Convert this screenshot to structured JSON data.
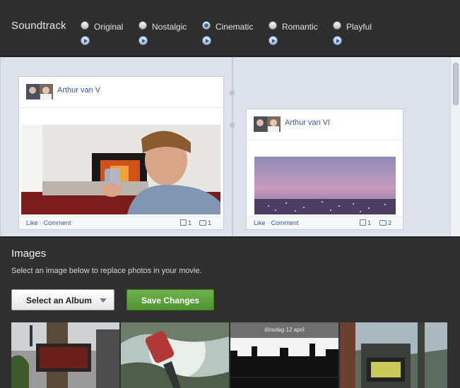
{
  "soundtrack": {
    "title": "Soundtrack",
    "options": [
      {
        "label": "Original",
        "checked": false
      },
      {
        "label": "Nostalgic",
        "checked": false
      },
      {
        "label": "Cinematic",
        "checked": true
      },
      {
        "label": "Romantic",
        "checked": false
      },
      {
        "label": "Playful",
        "checked": false
      }
    ]
  },
  "timeline": {
    "posts": [
      {
        "author": "Arthur van V",
        "like_label": "Like",
        "separator": "·",
        "comment_label": "Comment",
        "likes": "1",
        "comments": "1"
      },
      {
        "author": "Arthur van Vl",
        "like_label": "Like",
        "separator": "·",
        "comment_label": "Comment",
        "likes": "1",
        "comments": "2"
      }
    ]
  },
  "images": {
    "title": "Images",
    "subtitle": "Select an image below to replace photos in your movie.",
    "album_select_label": "Select an Album",
    "save_label": "Save Changes",
    "thumbnails": [
      {
        "name": "theater-sign-photo"
      },
      {
        "name": "tree-canopy-photo"
      },
      {
        "name": "city-skyline-photo",
        "caption": "dinsdag 12 april"
      },
      {
        "name": "street-clock-photo"
      }
    ]
  },
  "colors": {
    "accent_blue": "#3b5998",
    "save_green": "#5aa23a",
    "panel_dark": "#303030",
    "timeline_bg": "#dde1ea"
  }
}
